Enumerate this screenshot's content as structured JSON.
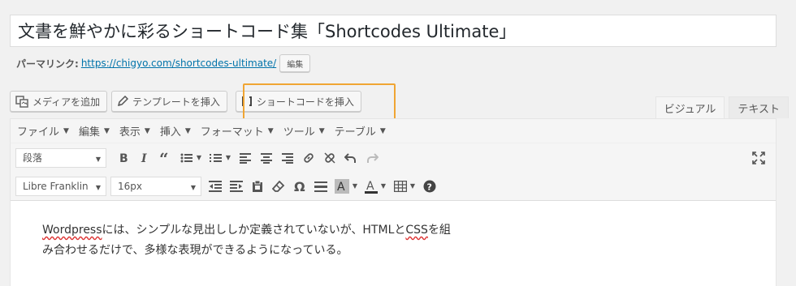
{
  "post": {
    "title": "文書を鮮やかに彩るショートコード集「Shortcodes Ultimate」"
  },
  "permalink": {
    "label": "パーマリンク:",
    "url": "https://chigyo.com/shortcodes-ultimate/",
    "edit_label": "編集"
  },
  "media_buttons": {
    "add_media": "メディアを追加",
    "template_insert": "テンプレートを挿入",
    "shortcode_insert": "ショートコードを挿入"
  },
  "editor_tabs": {
    "visual": "ビジュアル",
    "text": "テキスト"
  },
  "menubar": {
    "file": "ファイル",
    "edit": "編集",
    "view": "表示",
    "insert": "挿入",
    "format": "フォーマット",
    "tools": "ツール",
    "table": "テーブル"
  },
  "toolbar": {
    "block_format": "段落",
    "font_family": "Libre Franklin",
    "font_size": "16px"
  },
  "content": {
    "word1": "Wordpress",
    "seg1": "には、シンプルな見出ししか定義されていないが、HTMLと",
    "word2": "CSS",
    "seg2": "を組",
    "line2": "み合わせるだけで、多様な表現ができるようになっている。"
  },
  "colors": {
    "highlight_border": "#f0a533",
    "link": "#0073aa",
    "spellcheck": "#dd3333"
  }
}
